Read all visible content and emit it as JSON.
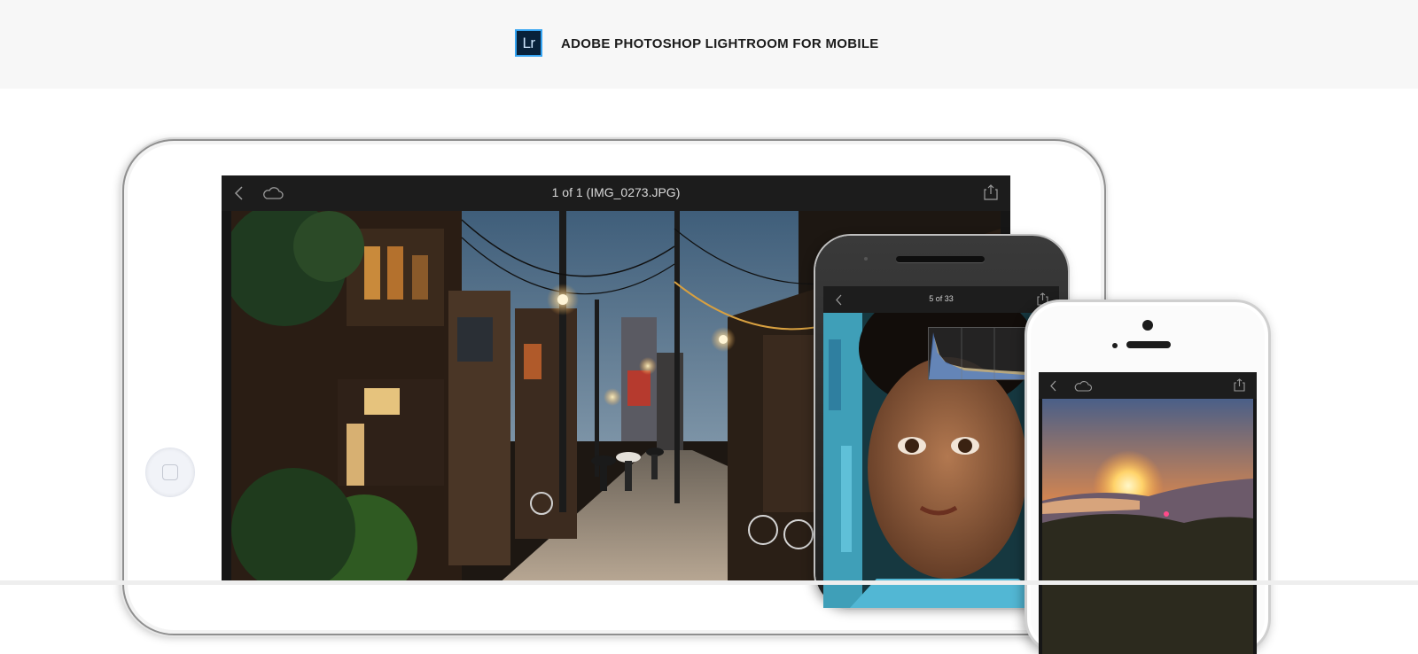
{
  "header": {
    "logo_text": "Lr",
    "title": "ADOBE PHOTOSHOP LIGHTROOM FOR MOBILE"
  },
  "ipad": {
    "screen_title": "1 of 1 (IMG_0273.JPG)",
    "toolbar_icons": [
      "back-chevron-icon",
      "cloud-icon",
      "share-icon"
    ]
  },
  "android": {
    "screen_title": "5 of 33",
    "toolbar_icons": [
      "back-chevron-icon",
      "share-icon"
    ]
  },
  "iphone": {
    "toolbar_icons": [
      "back-chevron-icon",
      "cloud-icon",
      "share-icon"
    ]
  },
  "colors": {
    "header_bg": "#f7f7f7",
    "lr_logo_bg": "#08213a",
    "lr_logo_border": "#35a4f2",
    "screen_bg": "#161616"
  }
}
